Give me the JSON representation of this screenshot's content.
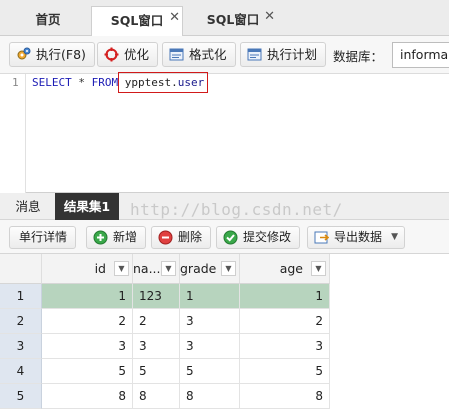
{
  "tabs": [
    {
      "label": "首页"
    },
    {
      "label": "SQL窗口",
      "close": "✕"
    },
    {
      "label": "SQL窗口",
      "close": "✕"
    }
  ],
  "toolbar": {
    "execute": "执行(F8)",
    "optimize": "优化",
    "format": "格式化",
    "explain": "执行计划",
    "db_label": "数据库：",
    "db_value": "informa"
  },
  "editor": {
    "line_number": "1",
    "kw_select": "SELECT",
    "star": "*",
    "kw_from": "FROM",
    "table_db": "ypptest",
    "dot": ".",
    "table_name": "user"
  },
  "result_tabs": [
    "消息",
    "结果集1"
  ],
  "watermark": "http://blog.csdn.net/",
  "result_toolbar": {
    "detail": "单行详情",
    "add": "新增",
    "delete": "删除",
    "commit": "提交修改",
    "export": "导出数据"
  },
  "grid": {
    "columns": [
      "id",
      "na...",
      "grade",
      "age"
    ],
    "rows": [
      {
        "n": "1",
        "id": "1",
        "name": "123",
        "grade": "1",
        "age": "1"
      },
      {
        "n": "2",
        "id": "2",
        "name": "2",
        "grade": "3",
        "age": "2"
      },
      {
        "n": "3",
        "id": "3",
        "name": "3",
        "grade": "3",
        "age": "3"
      },
      {
        "n": "4",
        "id": "5",
        "name": "5",
        "grade": "5",
        "age": "5"
      },
      {
        "n": "5",
        "id": "8",
        "name": "8",
        "grade": "8",
        "age": "8"
      }
    ]
  },
  "colors": {
    "accent_selected_row": "#b7d4be",
    "highlight_box": "#d11a1a",
    "keyword": "#1c1cb5"
  }
}
